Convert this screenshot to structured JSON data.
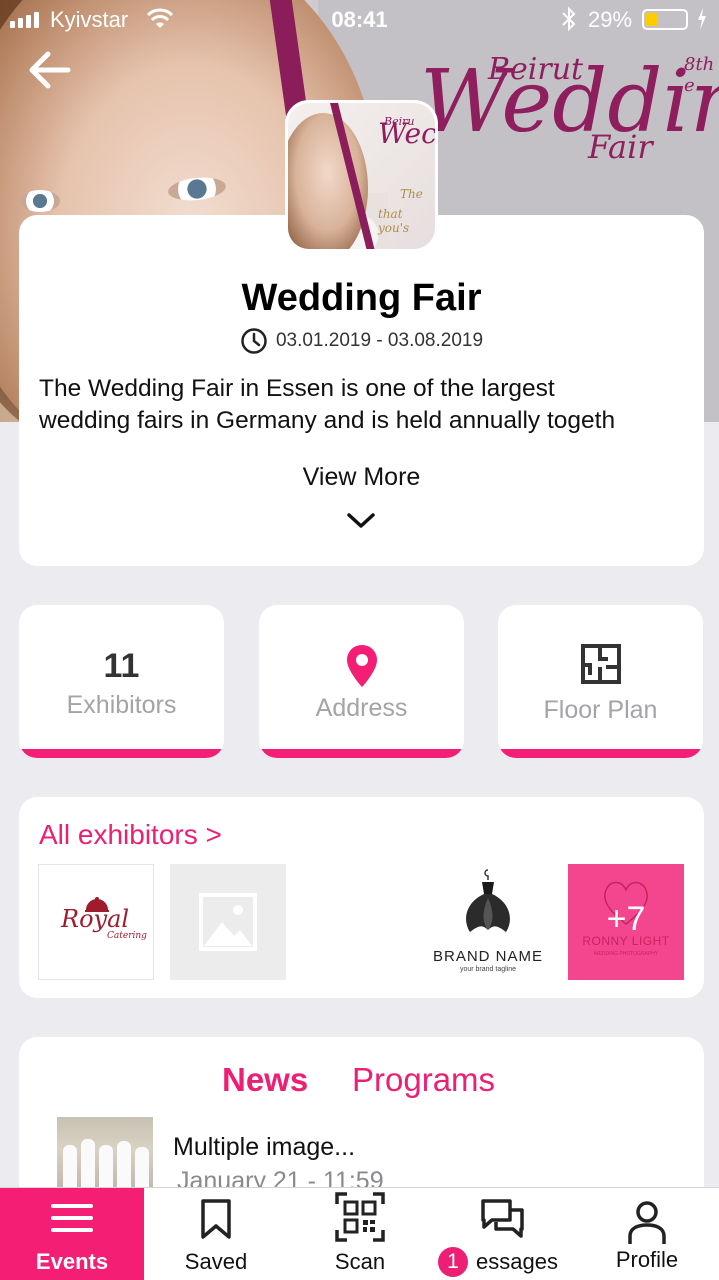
{
  "status_bar": {
    "carrier": "Kyivstar",
    "time": "08:41",
    "battery": "29%",
    "signal_bars": 4,
    "icons": [
      "signal-icon",
      "wifi-icon",
      "bluetooth-icon",
      "battery-icon",
      "charging-icon"
    ]
  },
  "hero": {
    "brand_line1": "Beirut",
    "brand_line2": "Wedding",
    "brand_line3": "Fair",
    "brand_edition": "8th e",
    "thumb_text1": "Wec",
    "thumb_text1_small": "Beiru",
    "thumb_text2": "The",
    "thumb_text3": "that you's"
  },
  "event": {
    "title": "Wedding Fair",
    "dates": "03.01.2019 - 03.08.2019",
    "description_line1": "The Wedding Fair in Essen is one of the largest",
    "description_line2": "wedding fairs in Germany and is held annually togeth",
    "view_more": "View More"
  },
  "stats": {
    "exhibitors_count": "11",
    "exhibitors_label": "Exhibitors",
    "address_label": "Address",
    "floor_plan_label": "Floor Plan"
  },
  "exhibitors": {
    "link": "All exhibitors >",
    "logo1_text": "Royal",
    "logo1_sub": "Catering",
    "logo3_text": "BRAND NAME",
    "logo3_tagline": "your brand tagline",
    "logo4_text": "RONNY LIGHT",
    "logo4_sub": "WEDDING PHOTOGRAPHY",
    "more_count": "+7"
  },
  "news": {
    "tab_news": "News",
    "tab_programs": "Programs",
    "item_title": "Multiple image...",
    "item_date": "January 21 - 11:59"
  },
  "tabbar": {
    "events": "Events",
    "saved": "Saved",
    "scan": "Scan",
    "messages": "essages",
    "messages_badge": "1",
    "profile": "Profile"
  },
  "colors": {
    "accent": "#f41e75",
    "accent_text": "#ec1f74",
    "background": "#ebebf0",
    "brand_purple": "#8a1d5a"
  }
}
